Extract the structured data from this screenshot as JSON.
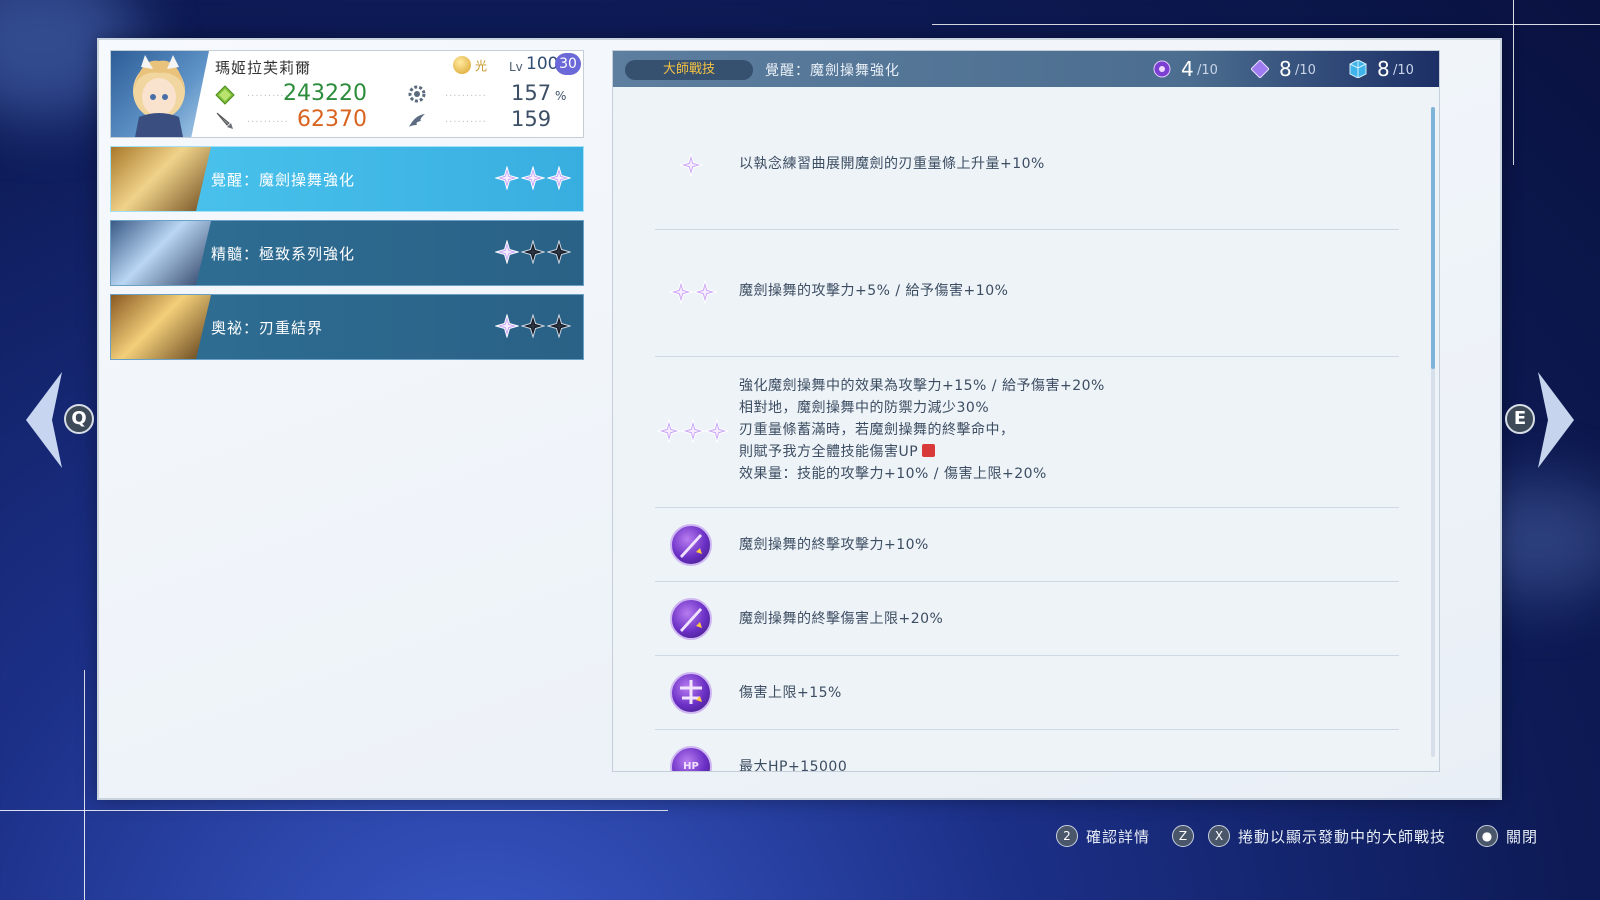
{
  "character": {
    "name": "瑪姬拉芙莉爾",
    "element": "光",
    "level_label": "Lv",
    "level": "100",
    "level_plus": "30",
    "hp": "243220",
    "atk": "62370",
    "crit": "157",
    "crit_unit": "%",
    "spd": "159"
  },
  "skills": [
    {
      "label": "覺醒：魔劍操舞強化",
      "filled": 3,
      "active": true
    },
    {
      "label": "精髓：極致系列強化",
      "filled": 1,
      "active": false
    },
    {
      "label": "奧祕：刃重結界",
      "filled": 1,
      "active": false
    }
  ],
  "header": {
    "tag": "大師戰技",
    "title": "覺醒：魔劍操舞強化",
    "counters": [
      {
        "icon": "purple-orb-icon",
        "value": "4",
        "max": "/10"
      },
      {
        "icon": "diamond-icon",
        "value": "8",
        "max": "/10"
      },
      {
        "icon": "cube-icon",
        "value": "8",
        "max": "/10"
      }
    ]
  },
  "entries": [
    {
      "icon": "star-1",
      "lines": [
        "以執念練習曲展開魔劍的刃重量條上升量+10%"
      ]
    },
    {
      "icon": "star-2",
      "lines": [
        "魔劍操舞的攻擊力+5% / 給予傷害+10%"
      ]
    },
    {
      "icon": "star-3",
      "lines": [
        "強化魔劍操舞中的效果為攻擊力+15% / 給予傷害+20%",
        "相對地，魔劍操舞中的防禦力減少30%",
        "刃重量條蓄滿時，若魔劍操舞的終擊命中，",
        "則賦予我方全體技能傷害UP",
        "效果量：技能的攻擊力+10% / 傷害上限+20%"
      ]
    },
    {
      "icon": "sword-orb-icon",
      "lines": [
        "魔劍操舞的終擊攻擊力+10%"
      ]
    },
    {
      "icon": "sword-orb-icon",
      "lines": [
        "魔劍操舞的終擊傷害上限+20%"
      ]
    },
    {
      "icon": "cap-orb-icon",
      "lines": [
        "傷害上限+15%"
      ]
    },
    {
      "icon": "hp-orb-icon",
      "lines": [
        "最大HP+15000"
      ]
    }
  ],
  "hp_badge": "HP",
  "nav": {
    "left_key": "Q",
    "right_key": "E"
  },
  "footer": {
    "confirm_key": "2",
    "confirm_label": "確認詳情",
    "scroll_key_1": "Z",
    "scroll_key_2": "X",
    "scroll_label": "捲動以顯示發動中的大師戰技",
    "close_label": "關閉"
  },
  "colors": {
    "accent": "#4cc5ee",
    "skill_row": "#2f6f95",
    "hp_green": "#2b8c3b",
    "atk_orange": "#d86420",
    "gold": "#f4c244"
  }
}
